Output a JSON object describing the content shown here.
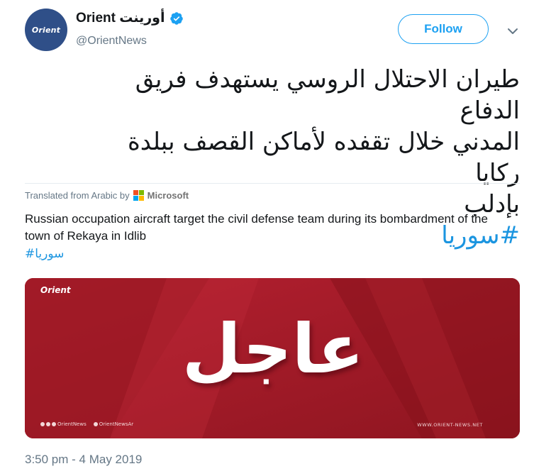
{
  "header": {
    "avatar_logo_text": "Orient",
    "display_name": "Orient أورينت",
    "handle": "@OrientNews",
    "follow_label": "Follow"
  },
  "tweet": {
    "text_lines": [
      "طيران الاحتلال الروسي يستهدف فريق الدفاع",
      "المدني خلال تقفده لأماكن القصف ببلدة ركايا",
      "بإدلب"
    ],
    "hashtag": "#سوريا"
  },
  "translation": {
    "translated_from": "Translated from Arabic by",
    "provider": "Microsoft",
    "text": "Russian occupation aircraft target the civil defense team during its bombardment of the town of Rekaya in Idlib",
    "hashtag": "#سوريا"
  },
  "media": {
    "logo_text": "Orient",
    "headline": "عاجل",
    "footer_left_1": "OrientNews",
    "footer_left_2": "OrientNewsAr",
    "footer_right": "WWW.ORIENT-NEWS.NET",
    "colors": {
      "background": "#a31b26",
      "dark_band": "#7e1019"
    }
  },
  "footer": {
    "timestamp": "3:50 pm - 4 May 2019"
  },
  "colors": {
    "accent": "#1da1f2",
    "link": "#1b95e0",
    "muted": "#657786"
  },
  "icons": {
    "verified": "verified-badge-icon",
    "menu": "chevron-down-icon",
    "translator": "microsoft-icon"
  }
}
